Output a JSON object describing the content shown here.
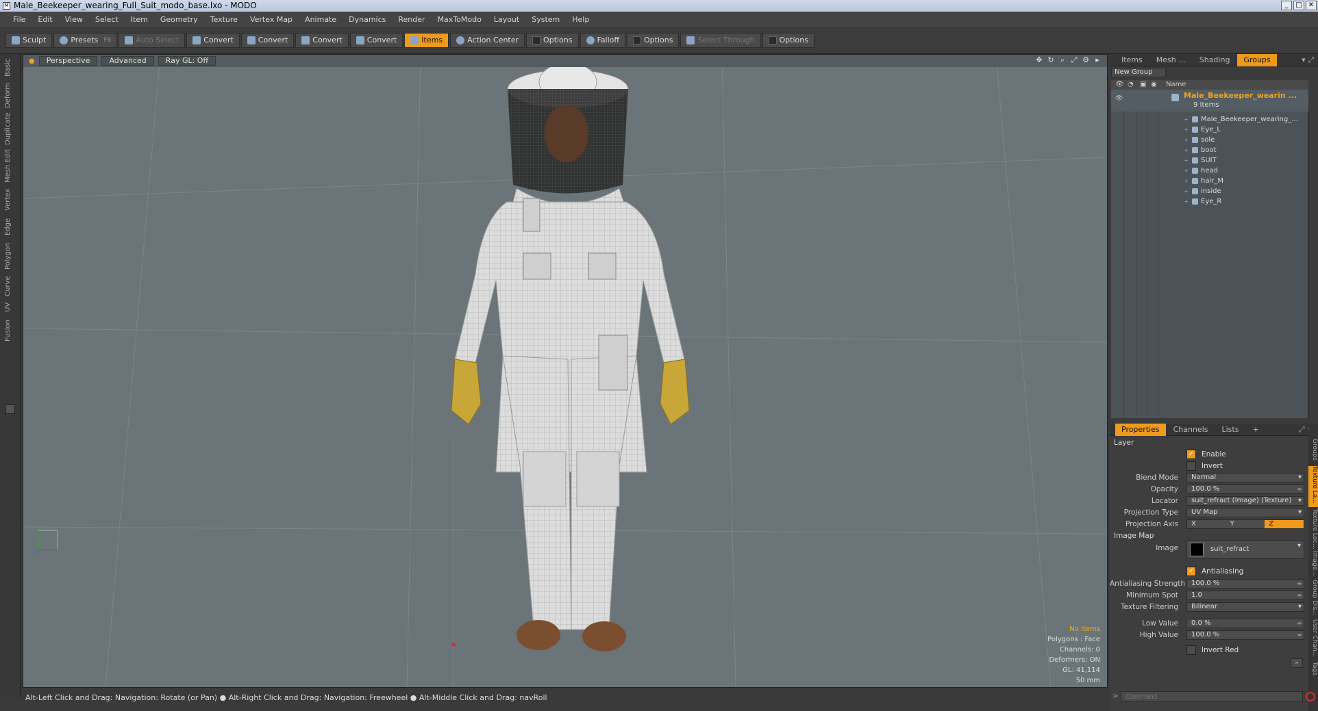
{
  "window": {
    "title": "Male_Beekeeper_wearing_Full_Suit_modo_base.lxo - MODO",
    "controls": [
      "_",
      "□",
      "✕"
    ]
  },
  "menu": [
    "File",
    "Edit",
    "View",
    "Select",
    "Item",
    "Geometry",
    "Texture",
    "Vertex Map",
    "Animate",
    "Dynamics",
    "Render",
    "MaxToModo",
    "Layout",
    "System",
    "Help"
  ],
  "toolbar": {
    "sculpt": "Sculpt",
    "presets": "Presets",
    "presets_key": "F6",
    "auto_select": "Auto Select",
    "convert": "Convert",
    "items": "Items",
    "action_center": "Action Center",
    "options": "Options",
    "falloff": "Falloff",
    "select_through": "Select Through"
  },
  "left_tabs": [
    "Basic",
    "Deform",
    "Duplicate",
    "Mesh Edit",
    "Vertex",
    "Edge",
    "Polygon",
    "Curve",
    "UV",
    "Fusion"
  ],
  "viewport": {
    "view": "Perspective",
    "shading": "Advanced",
    "raygl": "Ray GL: Off",
    "info": {
      "selection": "No Items",
      "polygons": "Polygons : Face",
      "channels": "Channels: 0",
      "deformers": "Deformers: ON",
      "gl": "GL: 41,114",
      "focal": "50 mm"
    }
  },
  "status": "Alt-Left Click and Drag: Navigation: Rotate (or Pan) ● Alt-Right Click and Drag: Navigation: Freewheel ● Alt-Middle Click and Drag: navRoll",
  "item_panel": {
    "tabs": [
      "Items",
      "Mesh ...",
      "Shading",
      "Groups"
    ],
    "active_tab": "Groups",
    "new_group": "New Group",
    "column_name": "Name",
    "group": {
      "name": "Male_Beekeeper_wearin ...",
      "count": "9 Items"
    },
    "children": [
      "Male_Beekeeper_wearing_...",
      "Eye_L",
      "sole",
      "boot",
      "SUIT",
      "head",
      "hair_M",
      "inside",
      "Eye_R"
    ]
  },
  "props_panel": {
    "tabs": [
      "Properties",
      "Channels",
      "Lists",
      "+"
    ],
    "layer": "Layer",
    "enable": "Enable",
    "invert": "Invert",
    "blend_mode_label": "Blend Mode",
    "blend_mode": "Normal",
    "opacity_label": "Opacity",
    "opacity": "100.0 %",
    "locator_label": "Locator",
    "locator": "suit_refract (Image) (Texture)",
    "projection_type_label": "Projection Type",
    "projection_type": "UV Map",
    "projection_axis_label": "Projection Axis",
    "axes": [
      "X",
      "Y",
      "Z"
    ],
    "axis_selected": "Z",
    "image_map": "Image Map",
    "image_label": "Image",
    "image": "suit_refract",
    "antialiasing": "Antialiasing",
    "aa_strength_label": "Antialiasing Strength",
    "aa_strength": "100.0 %",
    "min_spot_label": "Minimum Spot",
    "min_spot": "1.0",
    "tex_filter_label": "Texture Filtering",
    "tex_filter": "Bilinear",
    "low_label": "Low Value",
    "low": "0.0 %",
    "high_label": "High Value",
    "high": "100.0 %",
    "invert_red": "Invert Red",
    "command_placeholder": "Command",
    "side_tabs": [
      "Groups",
      "Texture La...",
      "Texture Loc...",
      "Image...",
      "Group Dis...",
      "User Chan...",
      "Tags"
    ]
  }
}
